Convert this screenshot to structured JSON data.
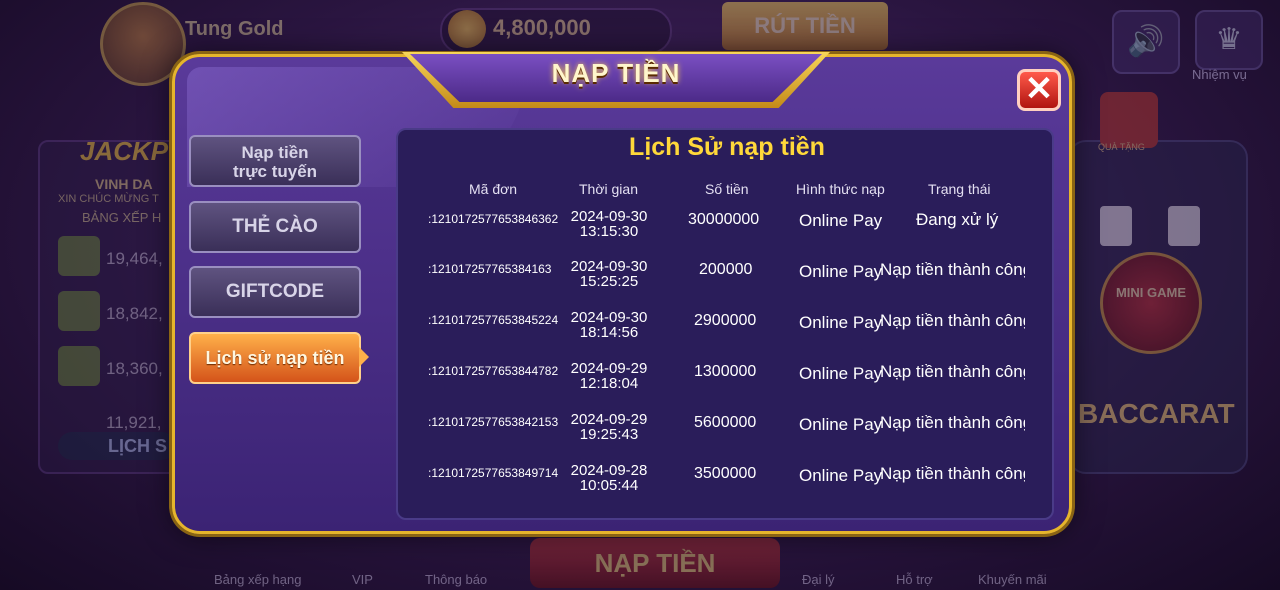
{
  "topbar": {
    "username": "Tung Gold",
    "balance": "4,800,000",
    "withdraw_label": "RÚT TIỀN",
    "mission_label": "Nhiệm vụ"
  },
  "jackpot": {
    "title": "JACKP",
    "line1": "VINH DA",
    "line2": "XIN CHÚC MỪNG T",
    "line3": "BẢNG XẾP H",
    "values": [
      "19,464,",
      "18,842,",
      "18,360,",
      "11,921,"
    ],
    "history_label": "LỊCH S"
  },
  "right_panel": {
    "gift_label": "QUÀ TẶNG",
    "mini_game_label": "MINI GAME",
    "baccarat_label": "BACCARAT"
  },
  "bottom_nav": {
    "items": [
      "Bảng xếp hạng",
      "VIP",
      "Thông báo",
      "Đại lý",
      "Hỗ trợ",
      "Khuyến mãi"
    ],
    "center_label": "NẠP TIỀN"
  },
  "modal": {
    "title": "NẠP TIỀN",
    "close_symbol": "✕",
    "menu": {
      "online": [
        "Nạp tiền",
        "trực tuyến"
      ],
      "card": "THẺ CÀO",
      "giftcode": "GIFTCODE",
      "history": "Lịch sử nạp tiền"
    },
    "history": {
      "title": "Lịch Sử nạp tiền",
      "columns": [
        "Mã đơn",
        "Thời gian",
        "Số tiền",
        "Hình thức nạp",
        "Trạng thái"
      ],
      "rows": [
        {
          "code": ":1210172577653846362",
          "date": "2024-09-30",
          "time": "13:15:30",
          "amount": "30000000",
          "method": "Online Pay",
          "status": "Đang xử lý"
        },
        {
          "code": ":121017257765384163",
          "date": "2024-09-30",
          "time": "15:25:25",
          "amount": "200000",
          "method": "Online Pay",
          "status": "Nạp tiền thành công"
        },
        {
          "code": ":1210172577653845224",
          "date": "2024-09-30",
          "time": "18:14:56",
          "amount": "2900000",
          "method": "Online Pay",
          "status": "Nạp tiền thành công"
        },
        {
          "code": ":1210172577653844782",
          "date": "2024-09-29",
          "time": "12:18:04",
          "amount": "1300000",
          "method": "Online Pay",
          "status": "Nạp tiền thành công"
        },
        {
          "code": ":1210172577653842153",
          "date": "2024-09-29",
          "time": "19:25:43",
          "amount": "5600000",
          "method": "Online Pay",
          "status": "Nạp tiền thành công"
        },
        {
          "code": ":1210172577653849714",
          "date": "2024-09-28",
          "time": "10:05:44",
          "amount": "3500000",
          "method": "Online Pay",
          "status": "Nạp tiền thành công"
        }
      ]
    }
  },
  "colors": {
    "modal_bg": "#4a2e88",
    "gold_border": "#e6b52c",
    "active_tab": "#e67a2a",
    "content_title": "#ffd83a"
  }
}
